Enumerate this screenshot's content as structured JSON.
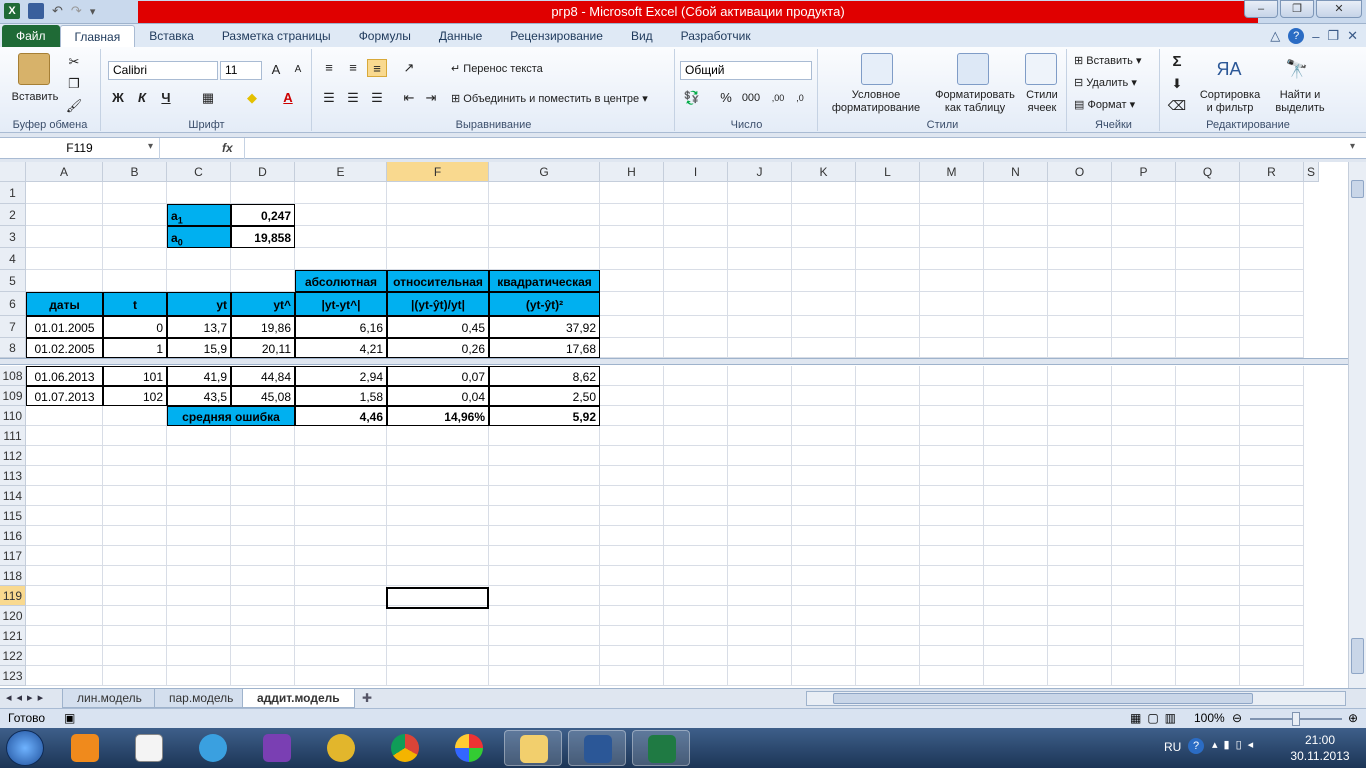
{
  "window": {
    "title": "ргр8  -  Microsoft Excel (Сбой активации продукта)",
    "minimize": "–",
    "restore": "❐",
    "close": "✕"
  },
  "ribbon_tabs": [
    "Файл",
    "Главная",
    "Вставка",
    "Разметка страницы",
    "Формулы",
    "Данные",
    "Рецензирование",
    "Вид",
    "Разработчик"
  ],
  "ribbon": {
    "clipboard": {
      "label": "Буфер обмена",
      "paste": "Вставить"
    },
    "font": {
      "label": "Шрифт",
      "name": "Calibri",
      "size": "11",
      "bold": "Ж",
      "italic": "К",
      "underline": "Ч"
    },
    "alignment": {
      "label": "Выравнивание",
      "wrap": "Перенос текста",
      "merge": "Объединить и поместить в центре"
    },
    "number": {
      "label": "Число",
      "format": "Общий",
      "percent": "%",
      "thousands": "000"
    },
    "styles": {
      "label": "Стили",
      "conditional": "Условное\nформатирование",
      "as_table": "Форматировать\nкак таблицу",
      "cell_styles": "Стили\nячеек"
    },
    "cells": {
      "label": "Ячейки",
      "insert": "Вставить",
      "delete": "Удалить",
      "format": "Формат"
    },
    "editing": {
      "label": "Редактирование",
      "sum": "Σ",
      "sort": "Сортировка\nи фильтр",
      "find": "Найти и\nвыделить"
    }
  },
  "formula_bar": {
    "name_box": "F119",
    "fx": "fx",
    "value": ""
  },
  "columns": [
    "A",
    "B",
    "C",
    "D",
    "E",
    "F",
    "G",
    "H",
    "I",
    "J",
    "K",
    "L",
    "M",
    "N",
    "O",
    "P",
    "Q",
    "R",
    "S"
  ],
  "top_rows": [
    "1",
    "2",
    "3",
    "4",
    "5",
    "6",
    "7",
    "8"
  ],
  "bottom_rows": [
    "108",
    "109",
    "110",
    "111",
    "112",
    "113",
    "114",
    "115",
    "116",
    "117",
    "118",
    "119",
    "120",
    "121",
    "122",
    "123"
  ],
  "cells": {
    "a1_label": "a",
    "a1_sub": "1",
    "a1_value": "0,247",
    "a0_label": "a",
    "a0_sub": "0",
    "a0_value": "19,858",
    "hdr_abs": "абсолютная",
    "hdr_rel": "относительная",
    "hdr_sq": "квадратическая",
    "h_dates": "даты",
    "h_t": "t",
    "h_yt": "yt",
    "h_yt_hat": "yt^",
    "h_abs": "|yt-yt^|",
    "h_rel": "|(yt-ŷt)/yt|",
    "h_sq": "(yt-ŷt)²",
    "avg_label": "средняя ошибка",
    "avg_abs": "4,46",
    "avg_rel": "14,96%",
    "avg_sq": "5,92"
  },
  "data_rows": [
    {
      "row": "7",
      "date": "01.01.2005",
      "t": "0",
      "yt": "13,7",
      "yhat": "19,86",
      "abs": "6,16",
      "rel": "0,45",
      "sq": "37,92"
    },
    {
      "row": "8",
      "date": "01.02.2005",
      "t": "1",
      "yt": "15,9",
      "yhat": "20,11",
      "abs": "4,21",
      "rel": "0,26",
      "sq": "17,68"
    },
    {
      "row": "108",
      "date": "01.06.2013",
      "t": "101",
      "yt": "41,9",
      "yhat": "44,84",
      "abs": "2,94",
      "rel": "0,07",
      "sq": "8,62"
    },
    {
      "row": "109",
      "date": "01.07.2013",
      "t": "102",
      "yt": "43,5",
      "yhat": "45,08",
      "abs": "1,58",
      "rel": "0,04",
      "sq": "2,50"
    }
  ],
  "sheets": [
    "лин.модель",
    "пар.модель",
    "аддит.модель"
  ],
  "status": {
    "ready": "Готово",
    "zoom": "100%"
  },
  "taskbar": {
    "lang": "RU",
    "time": "21:00",
    "date": "30.11.2013"
  }
}
